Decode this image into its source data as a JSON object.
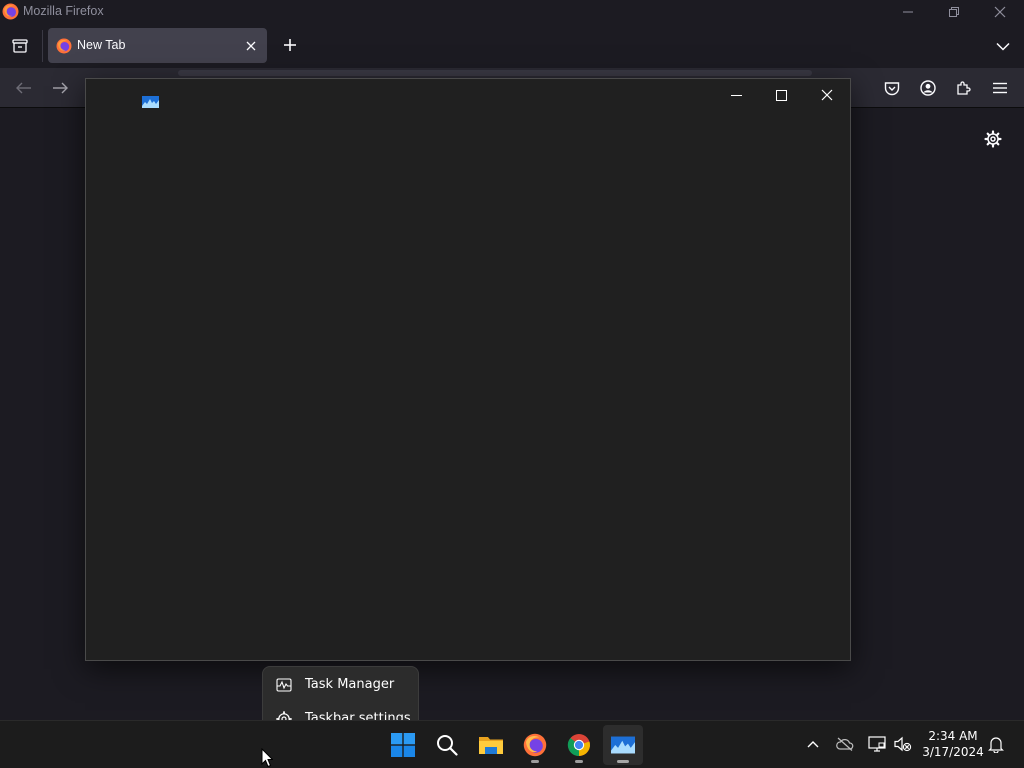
{
  "firefox": {
    "window_title": "Mozilla Firefox",
    "tab": {
      "title": "New Tab"
    }
  },
  "context_menu": {
    "items": [
      {
        "label": "Task Manager",
        "icon": "task-manager-icon"
      },
      {
        "label": "Taskbar settings",
        "icon": "gear-icon"
      }
    ]
  },
  "taskbar": {
    "apps": [
      "start",
      "search",
      "file-explorer",
      "firefox",
      "chrome",
      "task-manager"
    ],
    "clock": {
      "time": "2:34 AM",
      "date": "3/17/2024"
    }
  },
  "colors": {
    "firefox_bg": "#1c1b22",
    "toolbar_bg": "#2b2a33",
    "tab_selected": "#42414d",
    "taskmanager_bg": "#202020",
    "taskbar_bg": "#1c1c1c",
    "win_accent": "#0078d4"
  }
}
